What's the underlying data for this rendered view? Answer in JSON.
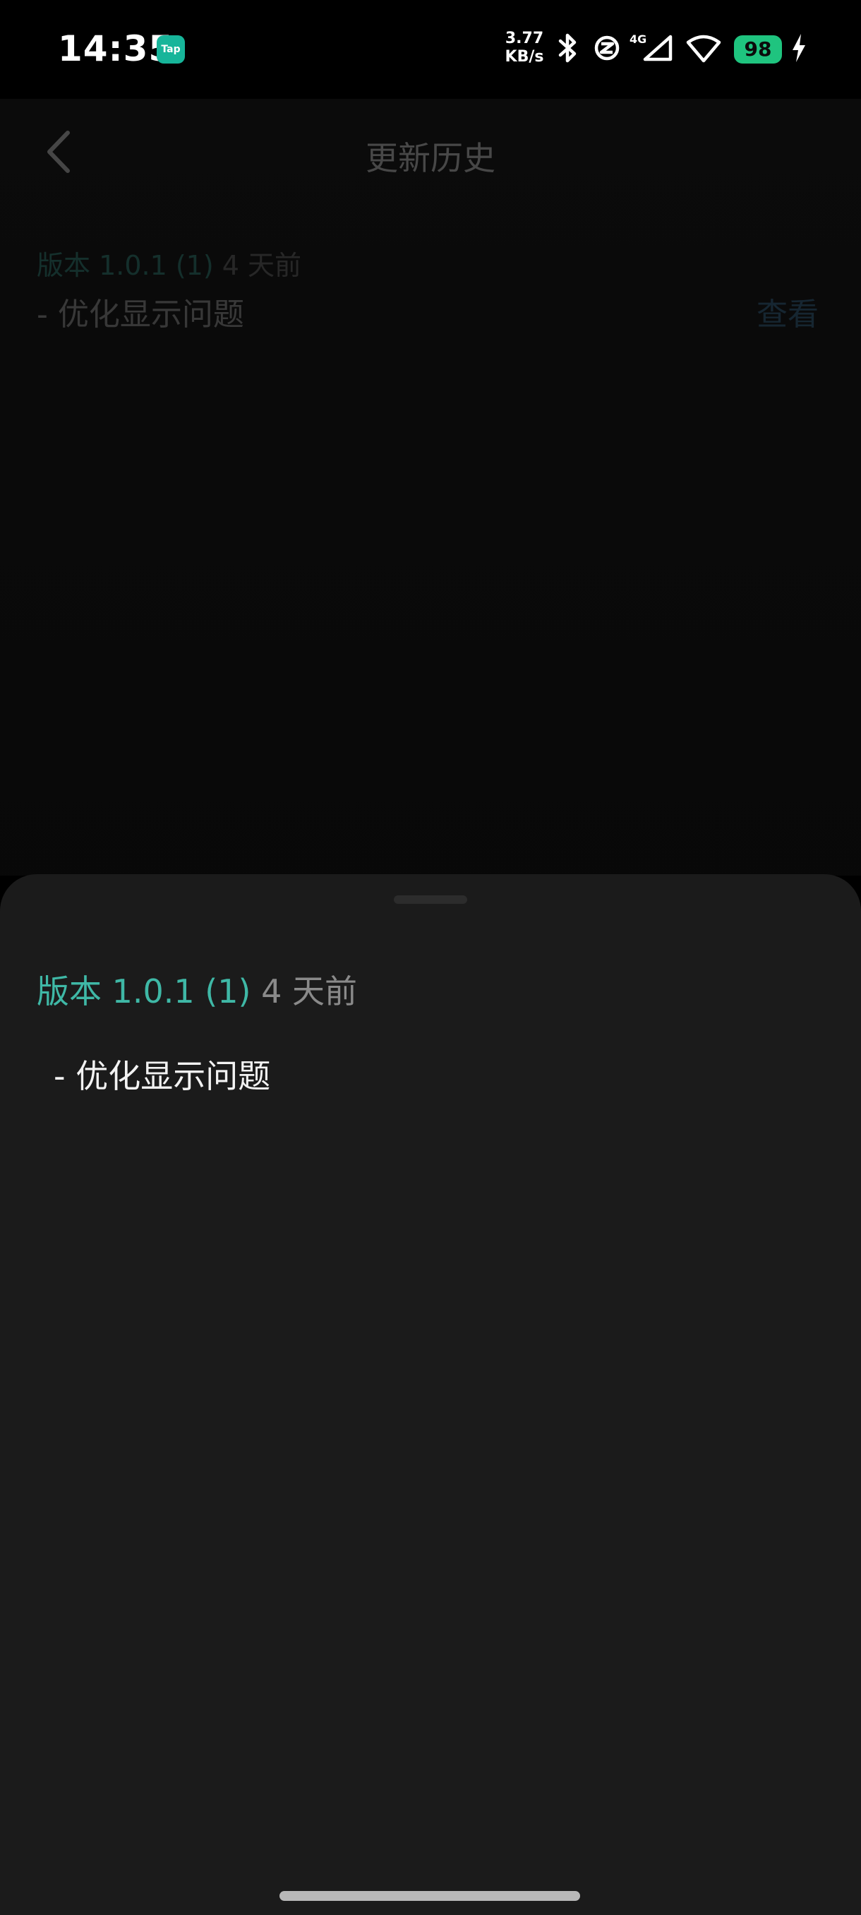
{
  "status_bar": {
    "time": "14:35",
    "app_badge": "Tap",
    "net_speed_value": "3.77",
    "net_speed_unit": "KB/s",
    "network_type": "4G",
    "battery_level": "98",
    "icons": [
      "tap-app-icon",
      "bluetooth-icon",
      "nfc-icon",
      "signal-icon",
      "wifi-icon",
      "battery-icon",
      "charging-icon"
    ],
    "battery_color": "#1fc47f"
  },
  "header": {
    "title": "更新历史",
    "back_icon": "chevron-left-icon"
  },
  "history": {
    "items": [
      {
        "version": "版本 1.0.1 (1)",
        "time_ago": "4 天前",
        "note": "- 优化显示问题",
        "action": "查看"
      }
    ]
  },
  "sheet": {
    "version": "版本 1.0.1 (1)",
    "time_ago": "4 天前",
    "note": "- 优化显示问题"
  },
  "colors": {
    "accent": "#3fb8a6",
    "sheet_bg": "#1b1b1b",
    "link": "#1f4b6a"
  }
}
